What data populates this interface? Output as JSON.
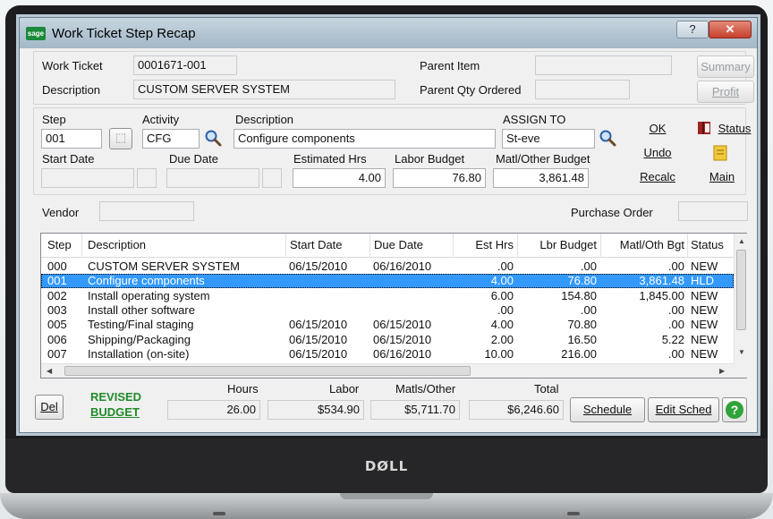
{
  "window": {
    "title": "Work Ticket Step Recap",
    "logo": "sage",
    "help": "?",
    "close": "✕"
  },
  "header": {
    "work_ticket_label": "Work Ticket",
    "work_ticket_value": "0001671-001",
    "description_label": "Description",
    "description_value": "CUSTOM SERVER SYSTEM",
    "parent_item_label": "Parent Item",
    "parent_item_value": "",
    "parent_qty_label": "Parent Qty Ordered",
    "parent_qty_value": "",
    "summary_button": "Summary",
    "profit_button": "Profit"
  },
  "step": {
    "step_label": "Step",
    "step_value": "001",
    "activity_label": "Activity",
    "activity_value": "CFG",
    "description_label": "Description",
    "description_value": "Configure components",
    "assign_label": "ASSIGN TO",
    "assign_value": "St-eve",
    "start_date_label": "Start Date",
    "start_date_value": "",
    "due_date_label": "Due Date",
    "due_date_value": "",
    "est_hrs_label": "Estimated Hrs",
    "est_hrs_value": "4.00",
    "labor_budget_label": "Labor Budget",
    "labor_budget_value": "76.80",
    "matl_budget_label": "Matl/Other Budget",
    "matl_budget_value": "3,861.48"
  },
  "actions": {
    "ok": "OK",
    "undo": "Undo",
    "recalc": "Recalc",
    "status": "Status",
    "main": "Main"
  },
  "vendor": {
    "vendor_label": "Vendor",
    "vendor_value": "",
    "po_label": "Purchase Order",
    "po_value": ""
  },
  "table": {
    "columns": [
      "Step",
      "Description",
      "Start Date",
      "Due Date",
      "Est Hrs",
      "Lbr Budget",
      "Matl/Oth Bgt",
      "Status"
    ],
    "rows": [
      {
        "step": "000",
        "description": "CUSTOM SERVER SYSTEM",
        "start": "06/15/2010",
        "due": "06/16/2010",
        "est": ".00",
        "lbr": ".00",
        "matl": ".00",
        "status": "NEW",
        "selected": false
      },
      {
        "step": "001",
        "description": "Configure components",
        "start": "",
        "due": "",
        "est": "4.00",
        "lbr": "76.80",
        "matl": "3,861.48",
        "status": "HLD",
        "selected": true
      },
      {
        "step": "002",
        "description": "Install operating system",
        "start": "",
        "due": "",
        "est": "6.00",
        "lbr": "154.80",
        "matl": "1,845.00",
        "status": "NEW",
        "selected": false
      },
      {
        "step": "003",
        "description": "Install other software",
        "start": "",
        "due": "",
        "est": ".00",
        "lbr": ".00",
        "matl": ".00",
        "status": "NEW",
        "selected": false
      },
      {
        "step": "005",
        "description": "Testing/Final staging",
        "start": "06/15/2010",
        "due": "06/15/2010",
        "est": "4.00",
        "lbr": "70.80",
        "matl": ".00",
        "status": "NEW",
        "selected": false
      },
      {
        "step": "006",
        "description": "Shipping/Packaging",
        "start": "06/15/2010",
        "due": "06/15/2010",
        "est": "2.00",
        "lbr": "16.50",
        "matl": "5.22",
        "status": "NEW",
        "selected": false
      },
      {
        "step": "007",
        "description": "Installation (on-site)",
        "start": "06/15/2010",
        "due": "06/16/2010",
        "est": "10.00",
        "lbr": "216.00",
        "matl": ".00",
        "status": "NEW",
        "selected": false
      }
    ]
  },
  "totals": {
    "revised": "REVISED",
    "budget": "BUDGET",
    "hours_label": "Hours",
    "hours_value": "26.00",
    "labor_label": "Labor",
    "labor_value": "$534.90",
    "matls_label": "Matls/Other",
    "matls_value": "$5,711.70",
    "total_label": "Total",
    "total_value": "$6,246.60"
  },
  "buttons": {
    "del": "Del",
    "schedule": "Schedule",
    "edit_sched": "Edit Sched",
    "help": "?"
  },
  "laptop": {
    "brand": "DØLL"
  },
  "colors": {
    "selection": "#3399ff",
    "revised_green": "#1f8a2a",
    "help_green": "#2fa33a"
  }
}
